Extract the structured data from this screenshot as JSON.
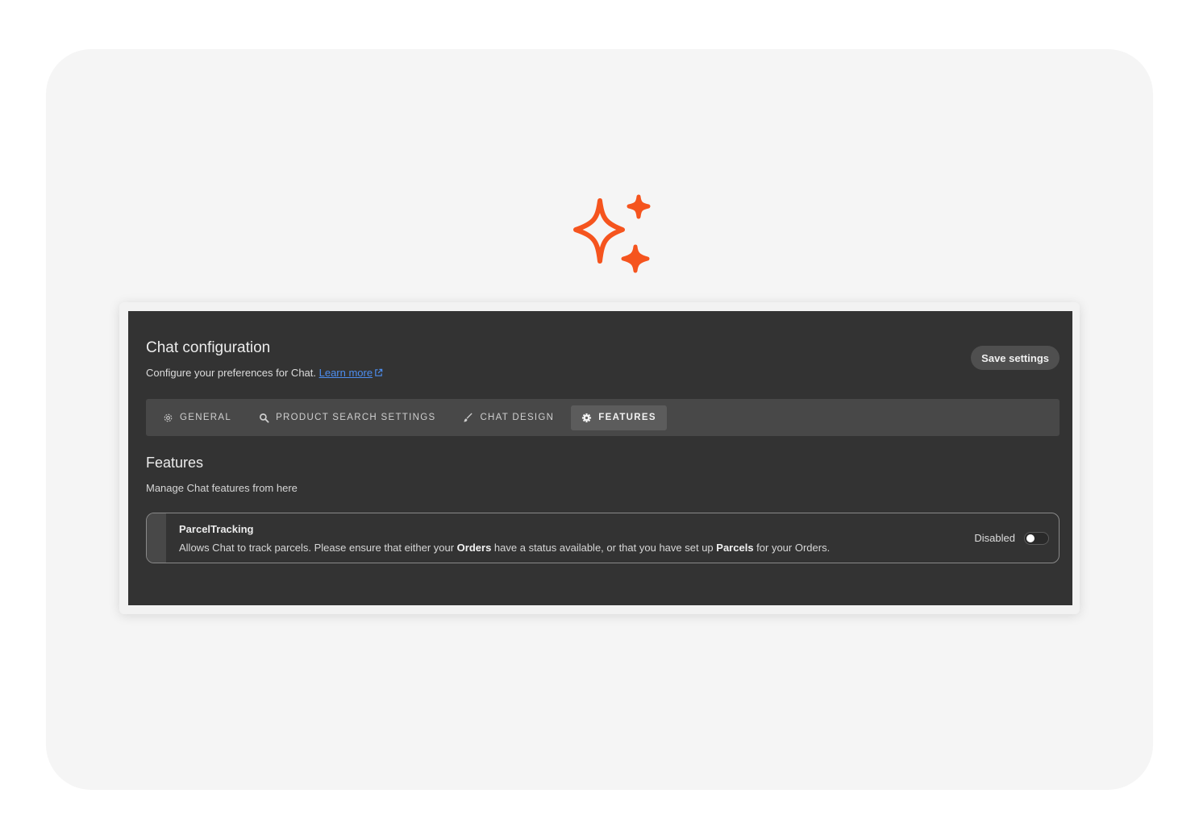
{
  "icons": {
    "sparkle": "sparkle-icon",
    "sparkle_color": "#f5541e"
  },
  "header": {
    "title": "Chat configuration",
    "subtitle_prefix": "Configure your preferences for Chat. ",
    "learn_more": "Learn more",
    "save_label": "Save settings"
  },
  "tabs": [
    {
      "label": "GENERAL",
      "icon": "gear-outline-icon"
    },
    {
      "label": "PRODUCT SEARCH SETTINGS",
      "icon": "search-icon"
    },
    {
      "label": "CHAT DESIGN",
      "icon": "brush-icon"
    },
    {
      "label": "FEATURES",
      "icon": "gear-icon",
      "active": true
    }
  ],
  "features": {
    "title": "Features",
    "subtitle": "Manage Chat features from here",
    "items": [
      {
        "name": "ParcelTracking",
        "desc_1": "Allows Chat to track parcels. Please ensure that either your ",
        "desc_bold_1": "Orders",
        "desc_2": " have a status available, or that you have set up ",
        "desc_bold_2": "Parcels",
        "desc_3": " for your Orders.",
        "status": "Disabled",
        "enabled": false
      }
    ]
  },
  "colors": {
    "panel_bg": "#333333",
    "link": "#4d8ef0"
  }
}
